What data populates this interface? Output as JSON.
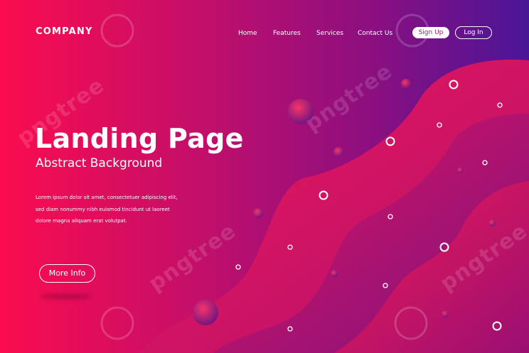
{
  "brand": {
    "name": "COMPANY"
  },
  "nav": {
    "items": [
      "Home",
      "Features",
      "Services",
      "Contact Us"
    ],
    "signup_label": "Sign Up",
    "login_label": "Log In"
  },
  "hero": {
    "title": "Landing Page",
    "subtitle": "Abstract Background",
    "body_lines": [
      "Lorem ipsum dolor sit amet, consectetuer adipiscing elit,",
      "sed diam nonummy nibh euismod tincidunt ut laoreet",
      "dolore magna aliquam erat volutpat."
    ],
    "cta_label": "More Info"
  },
  "watermark": {
    "text": "pngtree"
  },
  "colors": {
    "gradient_start": "#fb0c4f",
    "gradient_end": "#4a1598",
    "wave": "#f0185a"
  }
}
